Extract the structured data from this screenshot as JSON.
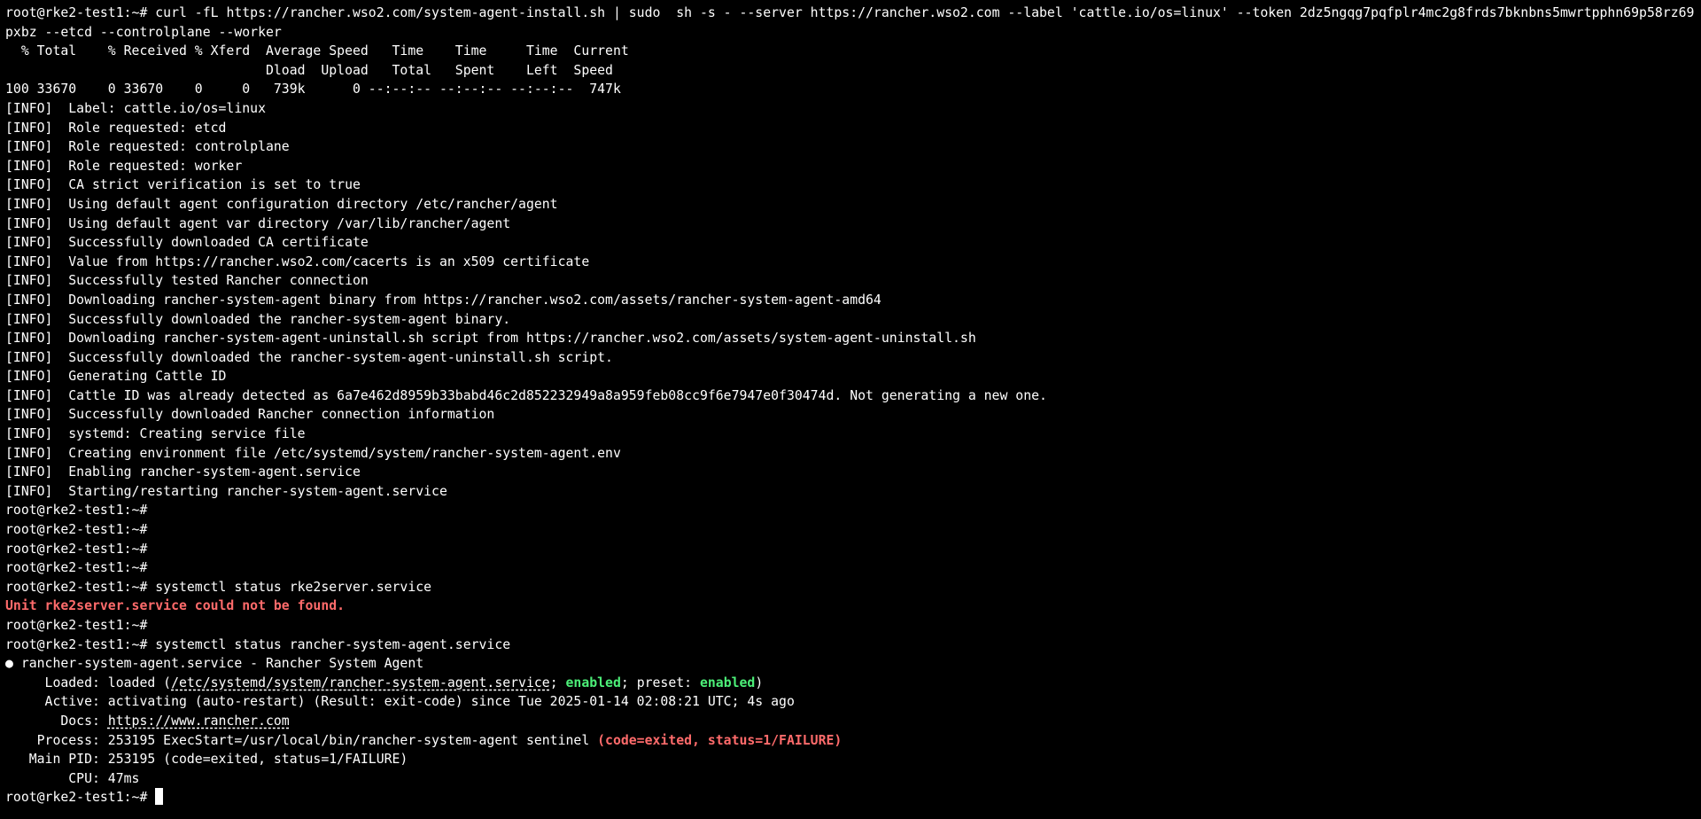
{
  "session": {
    "prompt": "root@rke2-test1:~# "
  },
  "install": {
    "command_line1": "curl -fL https://rancher.wso2.com/system-agent-install.sh | sudo  sh -s - --server https://rancher.wso2.com --label 'cattle.io/os=linux' --token 2dz5ngqg7pqfplr4mc2g8frds7bknbns5mwrtpphn69p58rz69",
    "command_line2": "pxbz --etcd --controlplane --worker",
    "curl_header1": "  % Total    % Received % Xferd  Average Speed   Time    Time     Time  Current",
    "curl_header2": "                                 Dload  Upload   Total   Spent    Left  Speed",
    "curl_progress": "100 33670    0 33670    0     0   739k      0 --:--:-- --:--:-- --:--:--  747k",
    "log_lines": [
      "[INFO]  Label: cattle.io/os=linux",
      "[INFO]  Role requested: etcd",
      "[INFO]  Role requested: controlplane",
      "[INFO]  Role requested: worker",
      "[INFO]  CA strict verification is set to true",
      "[INFO]  Using default agent configuration directory /etc/rancher/agent",
      "[INFO]  Using default agent var directory /var/lib/rancher/agent",
      "[INFO]  Successfully downloaded CA certificate",
      "[INFO]  Value from https://rancher.wso2.com/cacerts is an x509 certificate",
      "[INFO]  Successfully tested Rancher connection",
      "[INFO]  Downloading rancher-system-agent binary from https://rancher.wso2.com/assets/rancher-system-agent-amd64",
      "[INFO]  Successfully downloaded the rancher-system-agent binary.",
      "[INFO]  Downloading rancher-system-agent-uninstall.sh script from https://rancher.wso2.com/assets/system-agent-uninstall.sh",
      "[INFO]  Successfully downloaded the rancher-system-agent-uninstall.sh script.",
      "[INFO]  Generating Cattle ID",
      "[INFO]  Cattle ID was already detected as 6a7e462d8959b33babd46c2d852232949a8a959feb08cc9f6e7947e0f30474d. Not generating a new one.",
      "[INFO]  Successfully downloaded Rancher connection information",
      "[INFO]  systemd: Creating service file",
      "[INFO]  Creating environment file /etc/systemd/system/rancher-system-agent.env",
      "[INFO]  Enabling rancher-system-agent.service",
      "[INFO]  Starting/restarting rancher-system-agent.service"
    ]
  },
  "status1": {
    "command": "systemctl status rke2server.service",
    "error": "Unit rke2server.service could not be found."
  },
  "status2": {
    "command": "systemctl status rancher-system-agent.service",
    "header": "● rancher-system-agent.service - Rancher System Agent",
    "loaded_prefix": "     Loaded: loaded (",
    "loaded_path": "/etc/systemd/system/rancher-system-agent.service",
    "loaded_sep1": "; ",
    "loaded_enabled": "enabled",
    "loaded_sep2": "; preset: ",
    "loaded_preset": "enabled",
    "loaded_suffix": ")",
    "active": "     Active: activating (auto-restart) (Result: exit-code) since Tue 2025-01-14 02:08:21 UTC; 4s ago",
    "docs_prefix": "       Docs: ",
    "docs_url": "https://www.rancher.com",
    "process_text": "    Process: 253195 ExecStart=/usr/local/bin/rancher-system-agent sentinel ",
    "process_status": "(code=exited, status=1/FAILURE)",
    "main_pid": "   Main PID: 253195 (code=exited, status=1/FAILURE)",
    "cpu": "        CPU: 47ms"
  }
}
